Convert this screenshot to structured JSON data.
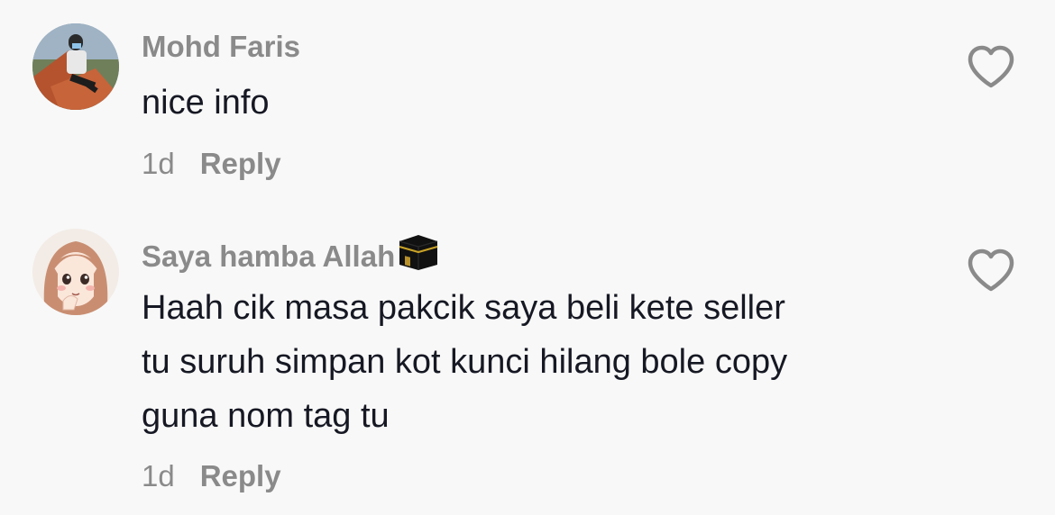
{
  "comments": [
    {
      "username": "Mohd Faris",
      "avatar": "photo-avatar",
      "text": "nice info",
      "time": "1d",
      "reply_label": "Reply",
      "like_icon": "heart-outline-icon"
    },
    {
      "username": "Saya hamba Allah",
      "username_emoji": "kaaba-icon",
      "avatar": "anime-girl-avatar",
      "text": "Haah cik masa pakcik saya beli kete seller\ntu suruh simpan kot kunci hilang bole copy\nguna nom tag tu",
      "time": "1d",
      "reply_label": "Reply",
      "like_icon": "heart-outline-icon"
    }
  ],
  "colors": {
    "background": "#f8f8f8",
    "text": "#161823",
    "muted": "#8a8a8a"
  }
}
